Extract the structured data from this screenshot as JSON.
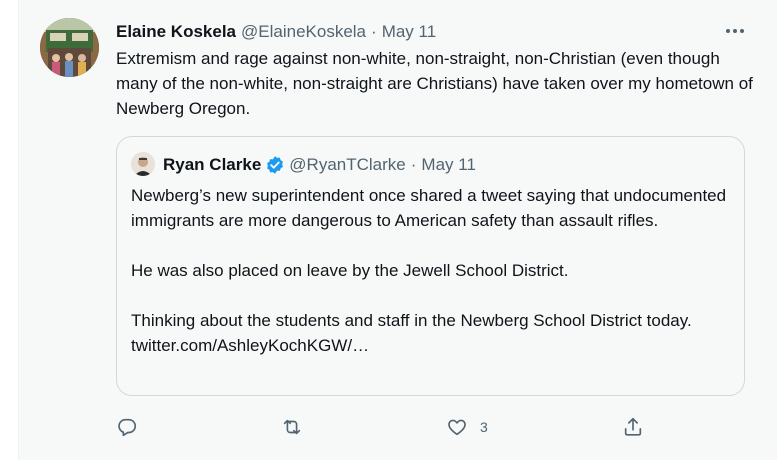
{
  "tweet": {
    "author_name": "Elaine Koskela",
    "author_handle": "@ElaineKoskela",
    "separator": "·",
    "date": "May 11",
    "more_icon": "more-icon",
    "text": "Extremism and rage against non-white, non-straight, non-Christian (even though many of the non-white, non-straight are Christians) have taken over my hometown of Newberg Oregon."
  },
  "quote": {
    "author_name": "Ryan Clarke",
    "verified_icon": "verified-badge-icon",
    "author_handle": "@RyanTClarke",
    "separator": "·",
    "date": "May 11",
    "paragraphs": [
      "Newberg’s new superintendent once shared a tweet saying that undocumented immigrants are more dangerous to American safety than assault rifles.",
      "He was also placed on leave by the Jewell School District.",
      "Thinking about the students and staff in the Newberg School District today. twitter.com/AshleyKochKGW/…"
    ]
  },
  "actions": {
    "reply_icon": "reply-icon",
    "retweet_icon": "retweet-icon",
    "like_icon": "heart-icon",
    "like_count": "3",
    "share_icon": "share-icon"
  },
  "colors": {
    "background": "#f7f9f9",
    "text": "#0f1419",
    "muted": "#536471",
    "verified": "#1d9bf0",
    "border": "#cfd9de"
  }
}
